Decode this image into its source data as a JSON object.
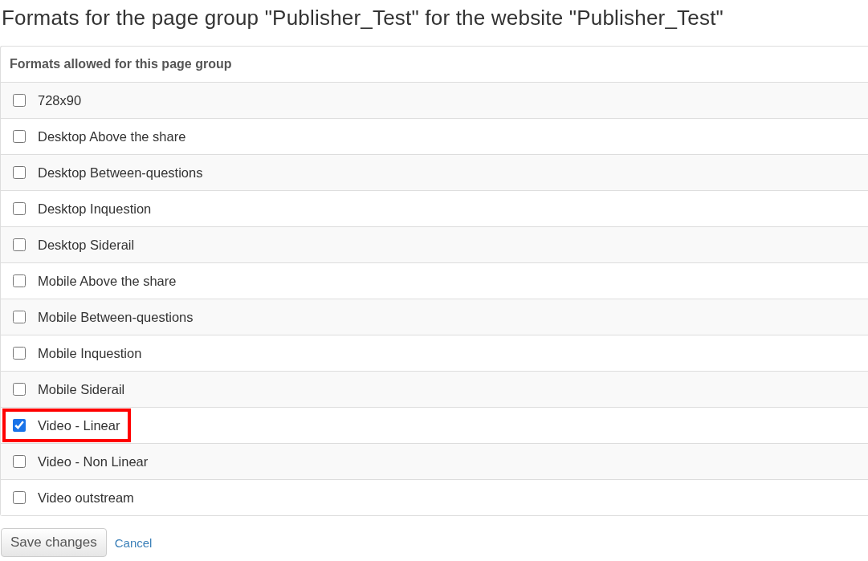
{
  "title": "Formats for the page group \"Publisher_Test\" for the website \"Publisher_Test\"",
  "table": {
    "header": "Formats allowed for this page group",
    "rows": [
      {
        "label": "728x90",
        "checked": false,
        "highlighted": false
      },
      {
        "label": "Desktop Above the share",
        "checked": false,
        "highlighted": false
      },
      {
        "label": "Desktop Between-questions",
        "checked": false,
        "highlighted": false
      },
      {
        "label": "Desktop Inquestion",
        "checked": false,
        "highlighted": false
      },
      {
        "label": "Desktop Siderail",
        "checked": false,
        "highlighted": false
      },
      {
        "label": "Mobile Above the share",
        "checked": false,
        "highlighted": false
      },
      {
        "label": "Mobile Between-questions",
        "checked": false,
        "highlighted": false
      },
      {
        "label": "Mobile Inquestion",
        "checked": false,
        "highlighted": false
      },
      {
        "label": "Mobile Siderail",
        "checked": false,
        "highlighted": false
      },
      {
        "label": "Video - Linear",
        "checked": true,
        "highlighted": true
      },
      {
        "label": "Video - Non Linear",
        "checked": false,
        "highlighted": false
      },
      {
        "label": "Video outstream",
        "checked": false,
        "highlighted": false
      }
    ]
  },
  "buttons": {
    "save": "Save changes",
    "cancel": "Cancel"
  }
}
